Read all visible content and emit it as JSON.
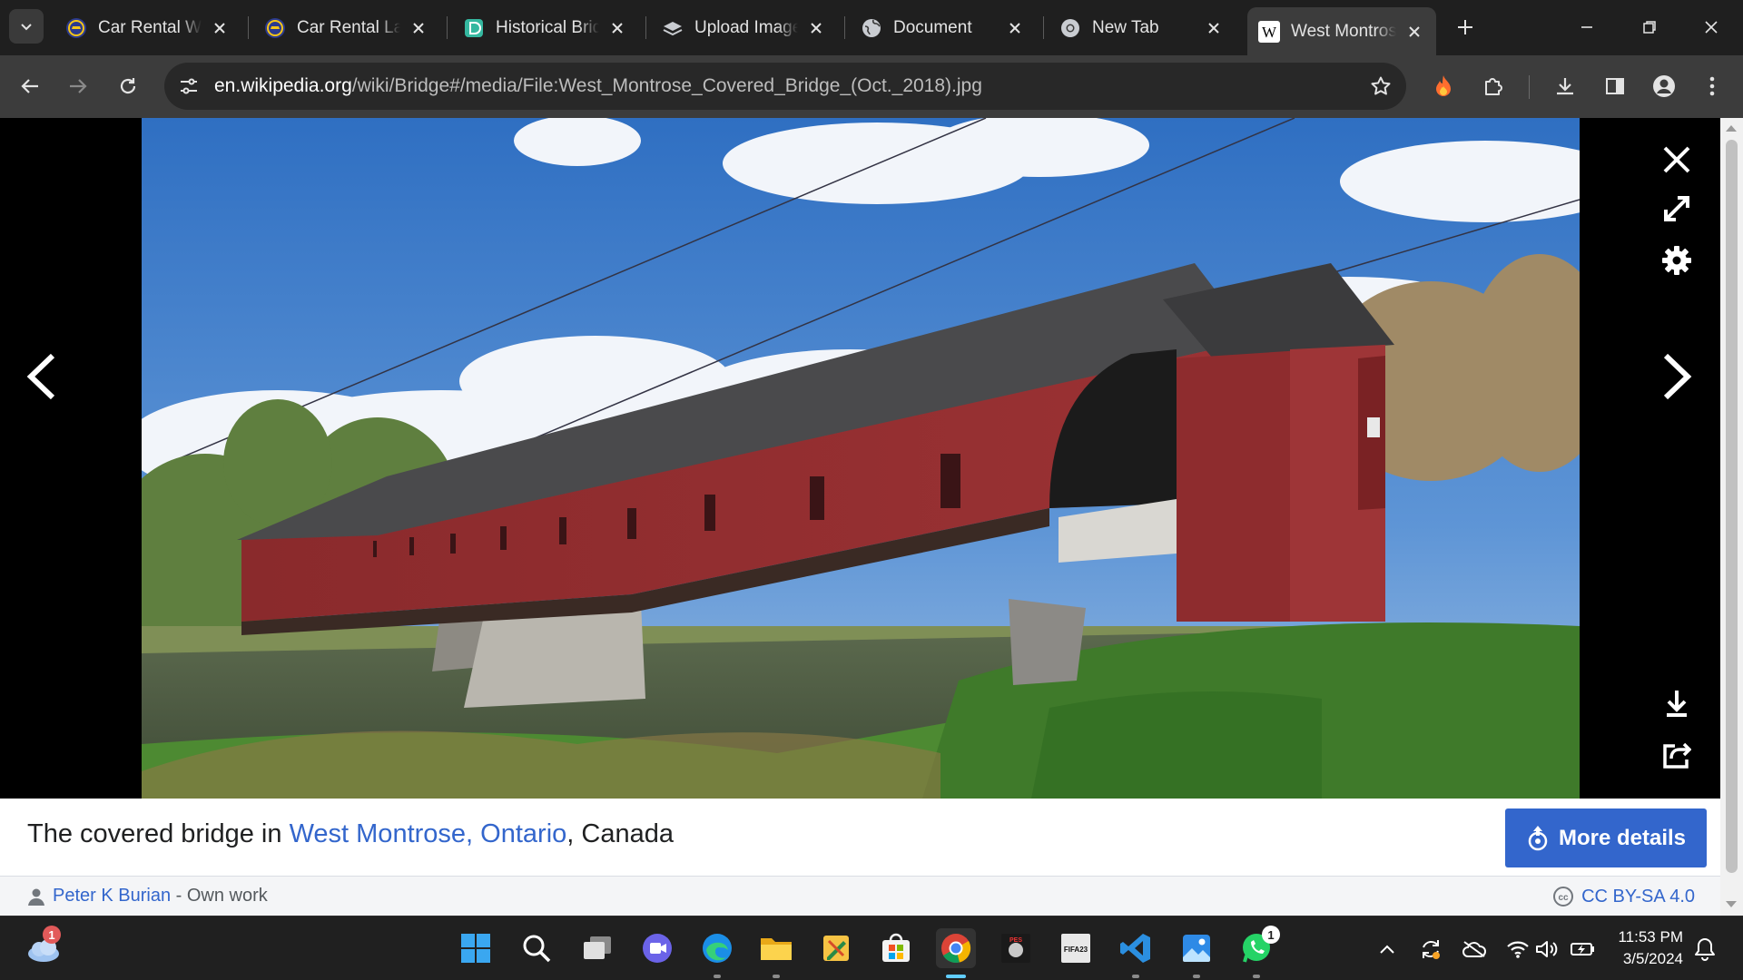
{
  "tabs": [
    {
      "title": "Car Rental Website",
      "icon": "car-rental-favicon",
      "active": false
    },
    {
      "title": "Car Rental Landing Page",
      "icon": "car-rental-favicon",
      "active": false
    },
    {
      "title": "Historical Bridges",
      "icon": "d-app-favicon",
      "active": false
    },
    {
      "title": "Upload Image",
      "icon": "layers-favicon",
      "active": false
    },
    {
      "title": "Document",
      "icon": "globe-favicon",
      "active": false
    },
    {
      "title": "New Tab",
      "icon": "chrome-favicon",
      "active": false
    },
    {
      "title": "West Montrose Covered Bridge",
      "icon": "wikipedia-favicon",
      "active": true
    }
  ],
  "toolbar": {
    "url_host": "en.wikipedia.org",
    "url_path": "/wiki/Bridge#/media/File:West_Montrose_Covered_Bridge_(Oct._2018).jpg"
  },
  "media": {
    "caption_prefix": "The covered bridge in ",
    "caption_link1": "West Montrose,",
    "caption_space": " ",
    "caption_link2": "Ontario",
    "caption_suffix": ", Canada",
    "more_details": "More details",
    "author_name": "Peter K Burian",
    "author_suffix": " - Own work",
    "license": "CC BY-SA 4.0"
  },
  "taskbar": {
    "weather_badge": "1",
    "whatsapp_badge": "1",
    "time": "11:53 PM",
    "date": "3/5/2024",
    "apps": [
      "start",
      "search",
      "task-view",
      "meet",
      "edge",
      "file-explorer",
      "pencil-app",
      "store",
      "chrome",
      "pes-game",
      "fifa-game",
      "vscode",
      "photos",
      "whatsapp"
    ]
  },
  "colors": {
    "wiki_blue": "#3366cc",
    "chrome_dark": "#1f1f1f",
    "toolbar": "#3c3c3c"
  }
}
